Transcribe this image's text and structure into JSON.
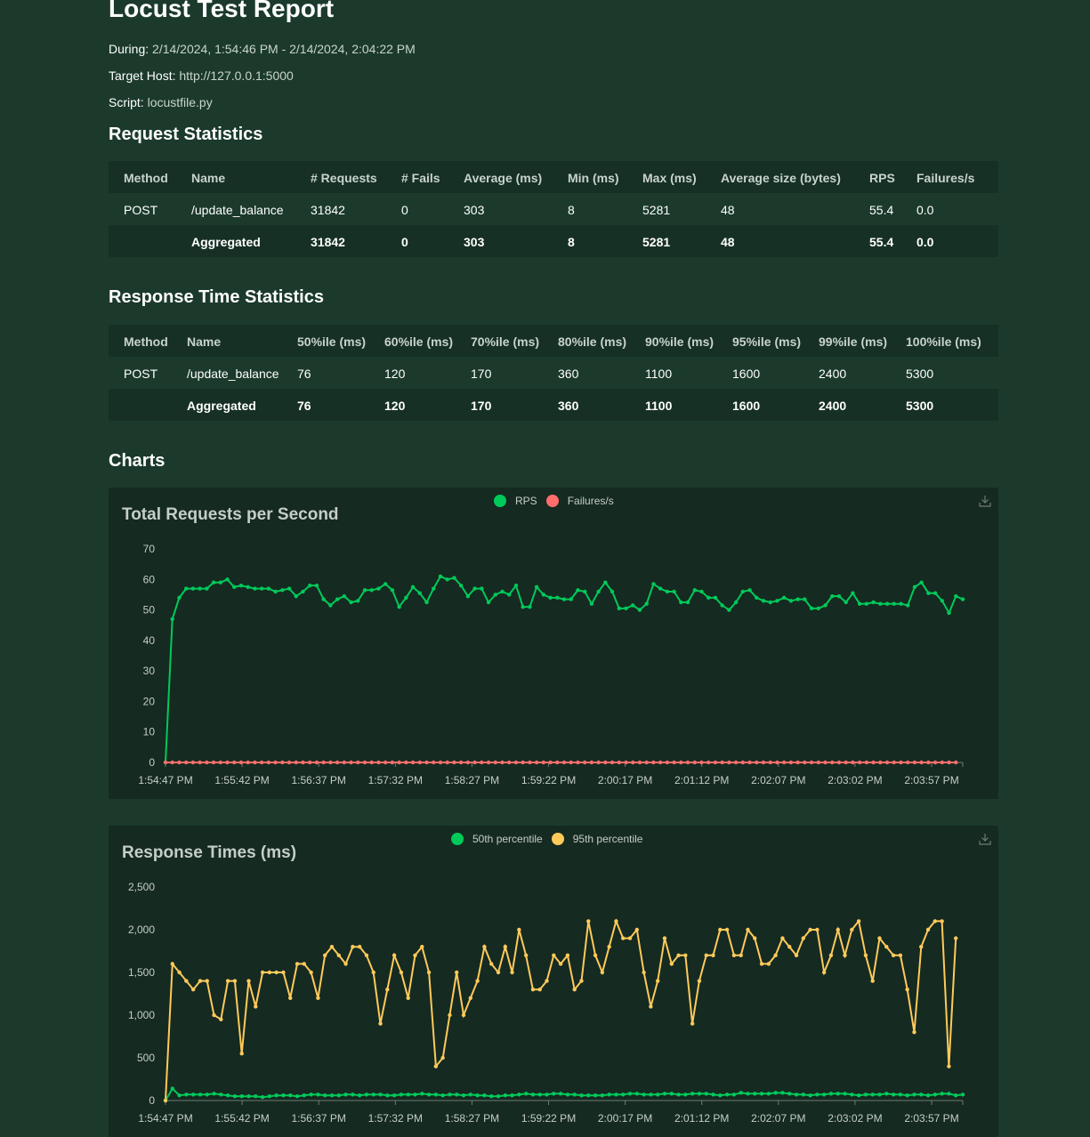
{
  "report": {
    "title": "Locust Test Report",
    "during_label": "During:",
    "during_value": "2/14/2024, 1:54:46 PM - 2/14/2024, 2:04:22 PM",
    "target_label": "Target Host:",
    "target_value": "http://127.0.0.1:5000",
    "script_label": "Script:",
    "script_value": "locustfile.py"
  },
  "request_stats": {
    "heading": "Request Statistics",
    "headers": [
      "Method",
      "Name",
      "# Requests",
      "# Fails",
      "Average (ms)",
      "Min (ms)",
      "Max (ms)",
      "Average size (bytes)",
      "RPS",
      "Failures/s"
    ],
    "rows": [
      [
        "POST",
        "/update_balance",
        "31842",
        "0",
        "303",
        "8",
        "5281",
        "48",
        "55.4",
        "0.0"
      ],
      [
        "",
        "Aggregated",
        "31842",
        "0",
        "303",
        "8",
        "5281",
        "48",
        "55.4",
        "0.0"
      ]
    ]
  },
  "response_stats": {
    "heading": "Response Time Statistics",
    "headers": [
      "Method",
      "Name",
      "50%ile (ms)",
      "60%ile (ms)",
      "70%ile (ms)",
      "80%ile (ms)",
      "90%ile (ms)",
      "95%ile (ms)",
      "99%ile (ms)",
      "100%ile (ms)"
    ],
    "rows": [
      [
        "POST",
        "/update_balance",
        "76",
        "120",
        "170",
        "360",
        "1100",
        "1600",
        "2400",
        "5300"
      ],
      [
        "",
        "Aggregated",
        "76",
        "120",
        "170",
        "360",
        "1100",
        "1600",
        "2400",
        "5300"
      ]
    ]
  },
  "charts_heading": "Charts",
  "chart_data": [
    {
      "type": "line",
      "title": "Total Requests per Second",
      "ylim": [
        0,
        70
      ],
      "yticks": [
        0,
        10,
        20,
        30,
        40,
        50,
        60,
        70
      ],
      "xtick_labels": [
        "1:54:47 PM",
        "1:55:42 PM",
        "1:56:37 PM",
        "1:57:32 PM",
        "1:58:27 PM",
        "1:59:22 PM",
        "2:00:17 PM",
        "2:01:12 PM",
        "2:02:07 PM",
        "2:03:02 PM",
        "2:03:57 PM"
      ],
      "legend": "top-center",
      "series": [
        {
          "name": "RPS",
          "color": "#00ca5a",
          "values": [
            0,
            47,
            54,
            57,
            57,
            57,
            57,
            59,
            59,
            60,
            57.5,
            58,
            57.5,
            57,
            57,
            57,
            56,
            56.5,
            57,
            54.5,
            56,
            58,
            58,
            53.5,
            51.5,
            53.5,
            54.5,
            52.5,
            53,
            56.5,
            56.5,
            57,
            58.5,
            56.5,
            51,
            54,
            57.5,
            55.5,
            52.5,
            57,
            61,
            60,
            60.5,
            58,
            54.5,
            57,
            57,
            52.5,
            55,
            56,
            55,
            58,
            51,
            51,
            57.5,
            55,
            54,
            54,
            53.5,
            53.5,
            56.5,
            56,
            52,
            56,
            59,
            56,
            50.5,
            50.5,
            51.5,
            50,
            52,
            58.5,
            57,
            56,
            56,
            52.5,
            52.5,
            56.5,
            56,
            54,
            54,
            51.5,
            50,
            52.5,
            56,
            56.5,
            54,
            53,
            52.5,
            53,
            54,
            53,
            53.5,
            53.5,
            50.5,
            50.5,
            51.5,
            54.5,
            54.5,
            52.5,
            55.5,
            52,
            52,
            52.5,
            52,
            52,
            52,
            52,
            51.5,
            57.5,
            59,
            55.5,
            55.5,
            53,
            49,
            54.5,
            53.5
          ]
        },
        {
          "name": "Failures/s",
          "color": "#ff6d6d",
          "values": [
            0,
            0,
            0,
            0,
            0,
            0,
            0,
            0,
            0,
            0,
            0,
            0,
            0,
            0,
            0,
            0,
            0,
            0,
            0,
            0,
            0,
            0,
            0,
            0,
            0,
            0,
            0,
            0,
            0,
            0,
            0,
            0,
            0,
            0,
            0,
            0,
            0,
            0,
            0,
            0,
            0,
            0,
            0,
            0,
            0,
            0,
            0,
            0,
            0,
            0,
            0,
            0,
            0,
            0,
            0,
            0,
            0,
            0,
            0,
            0,
            0,
            0,
            0,
            0,
            0,
            0,
            0,
            0,
            0,
            0,
            0,
            0,
            0,
            0,
            0,
            0,
            0,
            0,
            0,
            0,
            0,
            0,
            0,
            0,
            0,
            0,
            0,
            0,
            0,
            0,
            0,
            0,
            0,
            0,
            0,
            0,
            0,
            0,
            0,
            0,
            0,
            0,
            0,
            0,
            0,
            0,
            0,
            0,
            0,
            0,
            0,
            0,
            0,
            0,
            0,
            0
          ]
        }
      ]
    },
    {
      "type": "line",
      "title": "Response Times (ms)",
      "ylim": [
        0,
        2500
      ],
      "yticks": [
        0,
        500,
        1000,
        1500,
        2000,
        2500
      ],
      "ytick_labels": [
        "0",
        "500",
        "1,000",
        "1,500",
        "2,000",
        "2,500"
      ],
      "xtick_labels": [
        "1:54:47 PM",
        "1:55:42 PM",
        "1:56:37 PM",
        "1:57:32 PM",
        "1:58:27 PM",
        "1:59:22 PM",
        "2:00:17 PM",
        "2:01:12 PM",
        "2:02:07 PM",
        "2:03:02 PM",
        "2:03:57 PM"
      ],
      "legend": "top-center",
      "series": [
        {
          "name": "50th percentile",
          "color": "#00ca5a",
          "values": [
            0,
            140,
            60,
            70,
            70,
            70,
            70,
            80,
            70,
            60,
            50,
            50,
            50,
            50,
            40,
            50,
            60,
            60,
            60,
            50,
            60,
            70,
            70,
            60,
            60,
            60,
            70,
            70,
            60,
            70,
            70,
            70,
            60,
            60,
            70,
            70,
            70,
            80,
            70,
            70,
            60,
            70,
            70,
            60,
            70,
            60,
            60,
            50,
            50,
            60,
            60,
            70,
            80,
            70,
            70,
            70,
            80,
            80,
            70,
            70,
            60,
            60,
            60,
            60,
            70,
            70,
            70,
            80,
            80,
            70,
            70,
            70,
            80,
            80,
            70,
            70,
            80,
            80,
            80,
            70,
            60,
            70,
            70,
            90,
            80,
            80,
            80,
            80,
            90,
            90,
            80,
            70,
            70,
            60,
            70,
            70,
            80,
            80,
            80,
            70,
            60,
            70,
            70,
            70,
            80,
            70,
            70,
            60,
            70,
            70,
            60,
            70,
            80,
            80,
            60,
            70
          ]
        },
        {
          "name": "95th percentile",
          "color": "#ffca5a",
          "values": [
            0,
            1600,
            1500,
            1400,
            1300,
            1400,
            1400,
            1000,
            950,
            1400,
            1400,
            550,
            1400,
            1100,
            1500,
            1500,
            1500,
            1500,
            1200,
            1600,
            1600,
            1500,
            1200,
            1700,
            1800,
            1700,
            1600,
            1800,
            1800,
            1700,
            1500,
            900,
            1300,
            1700,
            1500,
            1200,
            1700,
            1800,
            1500,
            400,
            500,
            1000,
            1500,
            1000,
            1200,
            1400,
            1800,
            1600,
            1500,
            1800,
            1500,
            2000,
            1700,
            1300,
            1300,
            1400,
            1700,
            1600,
            1700,
            1300,
            1400,
            2100,
            1700,
            1500,
            1800,
            2100,
            1900,
            1900,
            2000,
            1500,
            1100,
            1400,
            1900,
            1600,
            1700,
            1700,
            900,
            1400,
            1700,
            1700,
            2000,
            2000,
            1700,
            1700,
            2000,
            1900,
            1600,
            1600,
            1700,
            1900,
            1800,
            1700,
            1900,
            2000,
            2000,
            1500,
            1700,
            2000,
            1700,
            2000,
            2100,
            1700,
            1400,
            1900,
            1800,
            1700,
            1700,
            1300,
            800,
            1800,
            2000,
            2100,
            2100,
            400,
            1900
          ]
        }
      ]
    }
  ]
}
